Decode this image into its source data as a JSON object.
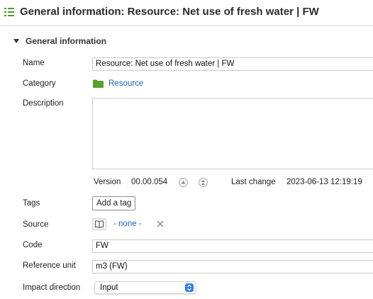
{
  "header": {
    "title": "General information: Resource: Net use of fresh water | FW",
    "icon": "outline-list-icon"
  },
  "section": {
    "label": "General information",
    "expanded": true
  },
  "form": {
    "name": {
      "label": "Name",
      "value": "Resource: Net use of fresh water | FW"
    },
    "category": {
      "label": "Category",
      "value": "Resource",
      "icon": "folder-icon",
      "color": "#5aa02c"
    },
    "description": {
      "label": "Description",
      "value": ""
    },
    "version": {
      "label": "Version",
      "value": "00.00.054",
      "last_change_label": "Last change",
      "last_change_value": "2023-06-13 12:19:19"
    },
    "tags": {
      "label": "Tags",
      "button": "Add a tag"
    },
    "source": {
      "label": "Source",
      "value": "- none -"
    },
    "code": {
      "label": "Code",
      "value": "FW"
    },
    "reference_unit": {
      "label": "Reference unit",
      "value": "m3 (FW)"
    },
    "impact_direction": {
      "label": "Impact direction",
      "value": "Input"
    }
  },
  "colors": {
    "link": "#1a66c9",
    "accent": "#2f7ff2",
    "header_icon": "#4c9a2a"
  }
}
